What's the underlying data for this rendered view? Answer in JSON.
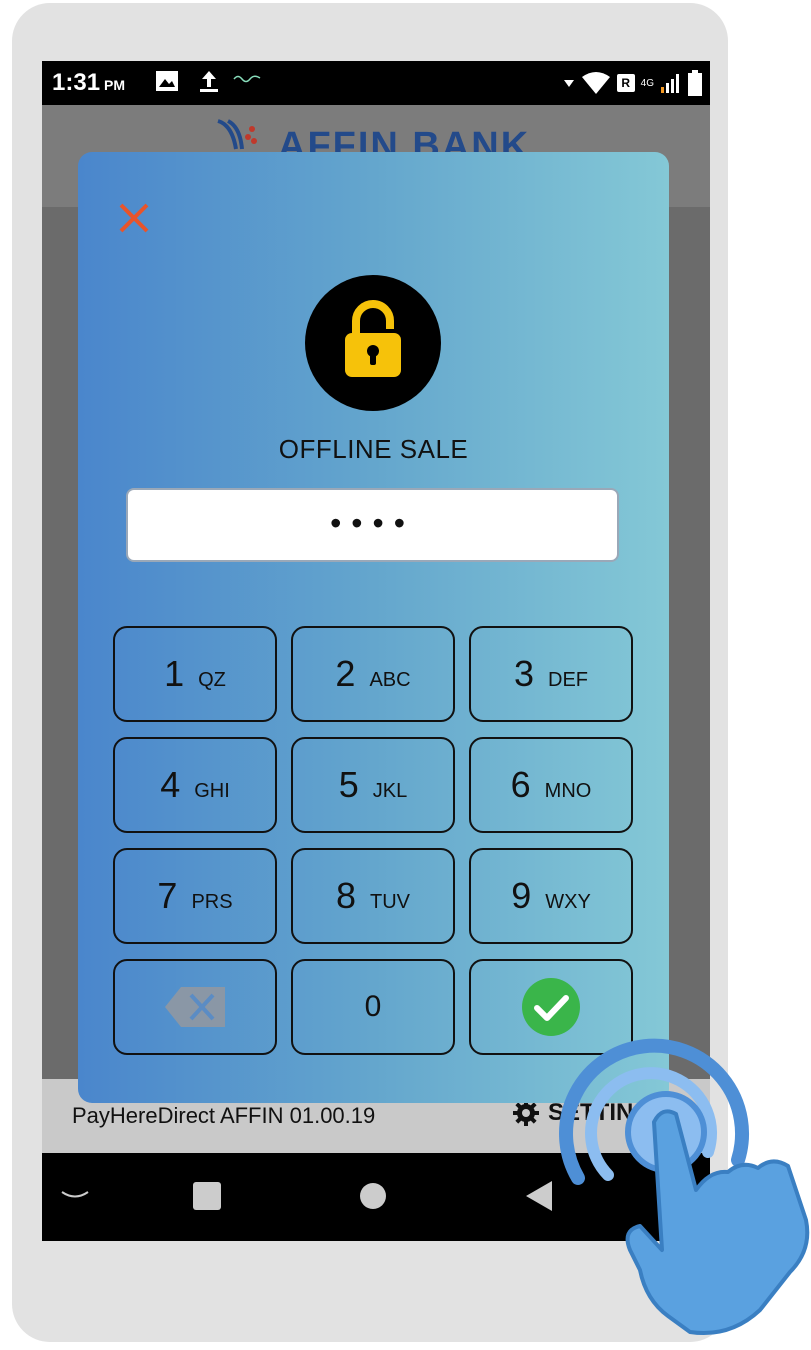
{
  "status_bar": {
    "time": "1:31",
    "ampm": "PM",
    "sim_badge": "R",
    "network": "4G"
  },
  "header": {
    "brand": "AFFIN BANK"
  },
  "dialog": {
    "title": "OFFLINE SALE",
    "pin_value": "••••",
    "close_icon": "close-icon",
    "lock_icon": "padlock-icon",
    "keys": [
      {
        "digit": "1",
        "letters": "QZ"
      },
      {
        "digit": "2",
        "letters": "ABC"
      },
      {
        "digit": "3",
        "letters": "DEF"
      },
      {
        "digit": "4",
        "letters": "GHI"
      },
      {
        "digit": "5",
        "letters": "JKL"
      },
      {
        "digit": "6",
        "letters": "MNO"
      },
      {
        "digit": "7",
        "letters": "PRS"
      },
      {
        "digit": "8",
        "letters": "TUV"
      },
      {
        "digit": "9",
        "letters": "WXY"
      },
      {
        "digit": "0",
        "letters": ""
      }
    ],
    "backspace_icon": "backspace-icon",
    "confirm_icon": "checkmark-icon"
  },
  "footer": {
    "version": "PayHereDirect AFFIN 01.00.19",
    "settings_label": "SETTINGS"
  },
  "colors": {
    "gradient_start": "#4a86cc",
    "gradient_end": "#84c8d6",
    "close_accent": "#e8542a",
    "lock_yellow": "#f6c20a",
    "confirm_green": "#3ab54a",
    "brand_blue": "#234a8a"
  }
}
